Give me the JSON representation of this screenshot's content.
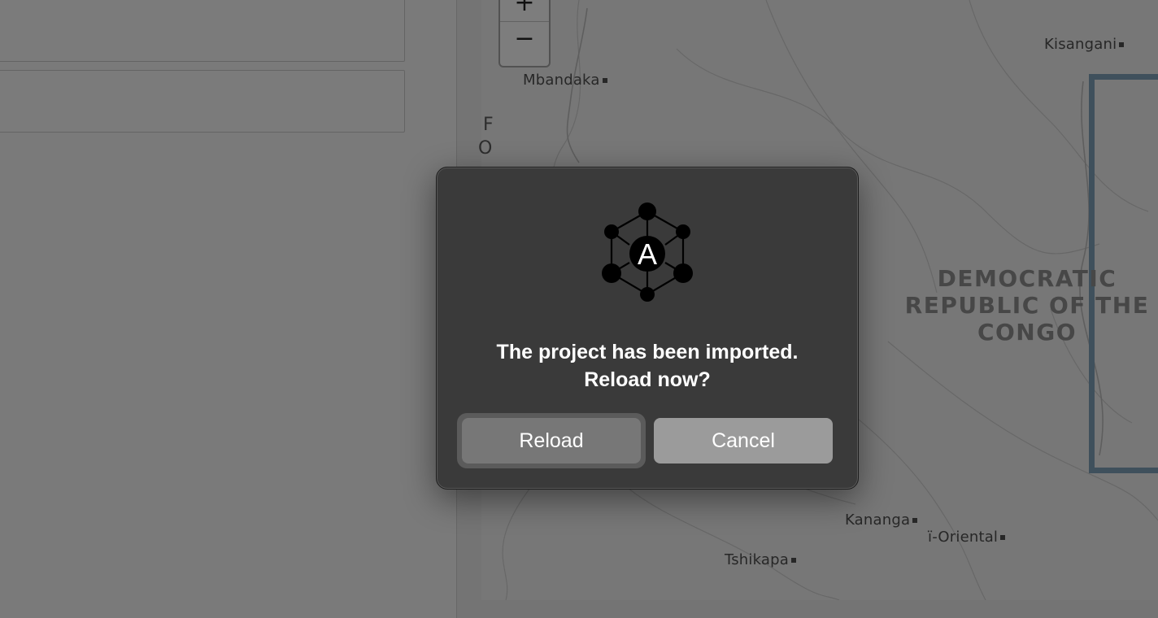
{
  "map": {
    "zoom_in_label": "+",
    "zoom_out_label": "−",
    "cities": [
      {
        "name": "Kisangani"
      },
      {
        "name": "Mbandaka"
      },
      {
        "name": "Kananga"
      },
      {
        "name": "ï-Oriental"
      },
      {
        "name": "Tshikapa"
      }
    ],
    "country_label": "DEMOCRATIC REPUBLIC OF THE CONGO",
    "fragments": [
      "F",
      "O"
    ]
  },
  "dialog": {
    "logo_letter": "A",
    "message_line1": "The project has been imported.",
    "message_line2": "Reload now?",
    "reload_label": "Reload",
    "cancel_label": "Cancel"
  }
}
